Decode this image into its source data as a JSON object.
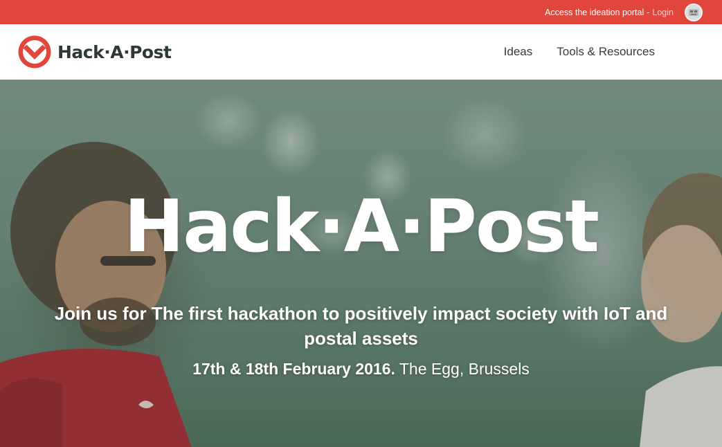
{
  "topbar": {
    "access_text": "Access the ideation portal",
    "separator": "-",
    "login_label": "Login",
    "avatar_icon": "user-avatar-icon",
    "background_color": "#e0463c"
  },
  "header": {
    "logo_text": "Hack·A·Post",
    "logo_icon": "envelope-check-logo-icon",
    "brand_color": "#e0463c",
    "nav": [
      {
        "label": "Ideas"
      },
      {
        "label": "Tools & Resources"
      }
    ]
  },
  "hero": {
    "title": "Hack·A·Post",
    "subtitle": "Join us for The first hackathon to positively impact society with IoT and postal assets",
    "date_strong": "17th & 18th February 2016.",
    "location": " The Egg, Brussels"
  }
}
